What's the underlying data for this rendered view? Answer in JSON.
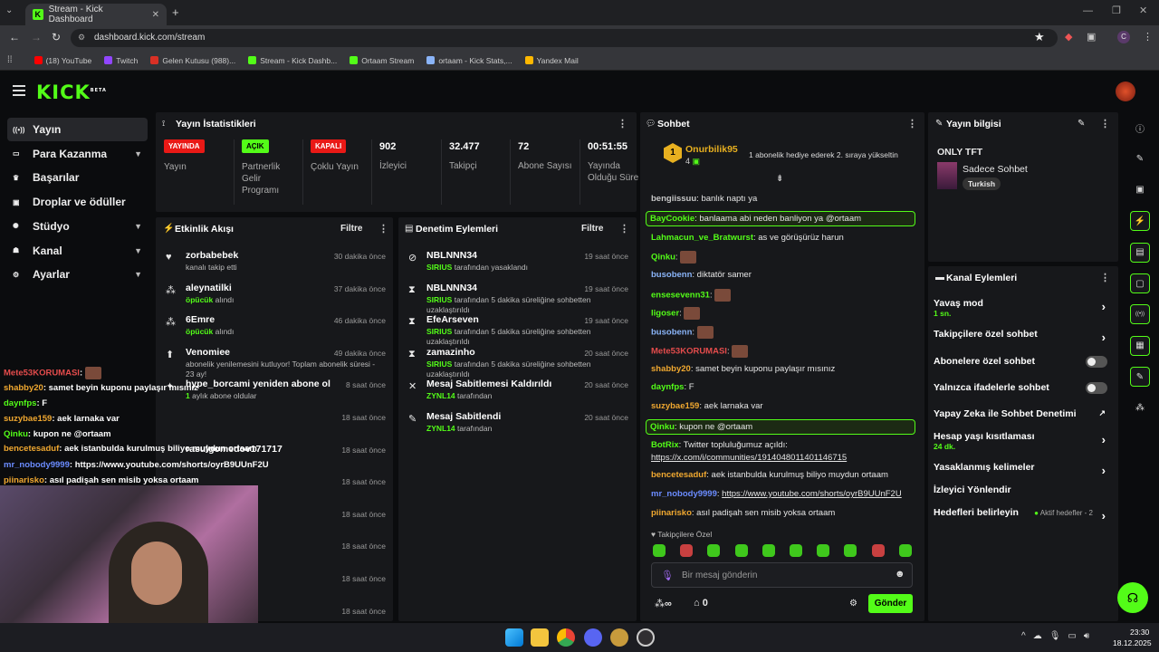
{
  "browser": {
    "tab_title": "Stream - Kick Dashboard",
    "url": "dashboard.kick.com/stream",
    "profile": "C",
    "bookmarks": [
      {
        "label": "(18) YouTube",
        "color": "#ff0000"
      },
      {
        "label": "Twitch",
        "color": "#9146ff"
      },
      {
        "label": "Gelen Kutusu (988)...",
        "color": "#d93025"
      },
      {
        "label": "Stream - Kick Dashb...",
        "color": "#53fc18"
      },
      {
        "label": "Ortaam Stream",
        "color": "#53fc18"
      },
      {
        "label": "ortaam - Kick Stats,...",
        "color": "#8ab4f8"
      },
      {
        "label": "Yandex Mail",
        "color": "#ffb800"
      }
    ]
  },
  "kick": {
    "logo": "KICK",
    "beta": "BETA"
  },
  "sidebar": {
    "items": [
      {
        "label": "Yayın",
        "icon": "broadcast-icon"
      },
      {
        "label": "Para Kazanma",
        "icon": "wallet-icon"
      },
      {
        "label": "Başarılar",
        "icon": "trophy-icon"
      },
      {
        "label": "Droplar ve ödüller",
        "icon": "gift-icon"
      },
      {
        "label": "Stüdyo",
        "icon": "gear-icon"
      },
      {
        "label": "Kanal",
        "icon": "user-icon"
      },
      {
        "label": "Ayarlar",
        "icon": "settings-icon"
      }
    ]
  },
  "stats": {
    "title": "Yayın İstatistikleri",
    "cols": [
      {
        "badge": "YAYINDA",
        "badge_color": "#e91916",
        "label": "Yayın"
      },
      {
        "badge": "AÇIK",
        "badge_color": "#53fc18",
        "label": "Partnerlik Gelir Programı"
      },
      {
        "badge": "KAPALI",
        "badge_color": "#e91916",
        "label": "Çoklu Yayın"
      },
      {
        "value": "902",
        "label": "İzleyici"
      },
      {
        "value": "32.477",
        "label": "Takipçi"
      },
      {
        "value": "72",
        "label": "Abone Sayısı"
      },
      {
        "value": "00:51:55",
        "label": "Yayında Olduğu Süre"
      }
    ]
  },
  "events": {
    "title": "Etkinlik Akışı",
    "filter": "Filtre",
    "items": [
      {
        "name": "zorbabebek",
        "sub": "kanalı takip etti",
        "time": "30 dakika önce"
      },
      {
        "name": "aleynatilki",
        "sub_green": "öpücük",
        "sub": " alındı",
        "time": "37 dakika önce"
      },
      {
        "name": "6Emre",
        "sub_green": "öpücük",
        "sub": " alındı",
        "time": "46 dakika önce"
      },
      {
        "name": "Venomiee",
        "sub": "abonelik yenilemesini kutluyor! Toplam abonelik süresi - 23 ay!",
        "time": "49 dakika önce"
      },
      {
        "name": "hype_borcami yeniden abone oldu!",
        "sub_green": "1",
        "sub": " aylık abone oldular",
        "time": "8 saat önce"
      },
      {
        "name": "",
        "time": "18 saat önce"
      },
      {
        "name": "rasulgomedov171717",
        "time": "18 saat önce"
      },
      {
        "name": "",
        "time": "18 saat önce"
      },
      {
        "name": "",
        "time": "18 saat önce"
      },
      {
        "name": "",
        "time": "18 saat önce"
      },
      {
        "name": "",
        "time": "18 saat önce"
      },
      {
        "name": "",
        "time": "18 saat önce"
      }
    ]
  },
  "mod": {
    "title": "Denetim Eylemleri",
    "filter": "Filtre",
    "items": [
      {
        "name": "NBLNNN34",
        "by": "SIRIUS",
        "sub": " tarafından yasaklandı",
        "time": "19 saat önce"
      },
      {
        "name": "NBLNNN34",
        "by": "SIRIUS",
        "sub": " tarafından 5 dakika süreliğine sohbetten uzaklaştırıldı",
        "time": "19 saat önce"
      },
      {
        "name": "EfeArseven",
        "by": "SIRIUS",
        "sub": " tarafından 5 dakika süreliğine sohbetten uzaklaştırıldı",
        "time": "19 saat önce"
      },
      {
        "name": "zamazinho",
        "by": "SIRIUS",
        "sub": " tarafından 5 dakika süreliğine sohbetten uzaklaştırıldı",
        "time": "20 saat önce"
      },
      {
        "name": "Mesaj Sabitlemesi Kaldırıldı",
        "by": "ZYNL14",
        "sub": " tarafından",
        "time": "20 saat önce"
      },
      {
        "name": "Mesaj Sabitlendi",
        "by": "ZYNL14",
        "sub": " tarafından",
        "time": "20 saat önce"
      }
    ]
  },
  "chat": {
    "title": "Sohbet",
    "pinned_user": "Onurbilik95",
    "pinned_count": "4",
    "pinned_msg": "1 abonelik hediye ederek 2. sıraya yükseltin",
    "lines": [
      {
        "user": "bengiissuu",
        "color": "#c7c7c7",
        "msg": "banlık naptı ya"
      },
      {
        "user": "BayCookie",
        "color": "#53fc18",
        "msg": "banlaama abi neden banliyon ya @ortaam",
        "hl": true
      },
      {
        "user": "Lahmacun_ve_Bratwurst",
        "color": "#53fc18",
        "msg": "as ve görüşürüz harun"
      },
      {
        "user": "Qinku",
        "color": "#53fc18",
        "msg": ""
      },
      {
        "user": "busobenn",
        "color": "#8ab4f8",
        "msg": "diktatör samer"
      },
      {
        "user": "ensesevenn31",
        "color": "#53fc18",
        "msg": ""
      },
      {
        "user": "ligoser",
        "color": "#53fc18",
        "msg": ""
      },
      {
        "user": "busobenn",
        "color": "#8ab4f8",
        "msg": ""
      },
      {
        "user": "Mete53KORUMASI",
        "color": "#e54c4c",
        "msg": ""
      },
      {
        "user": "shabby20",
        "color": "#f0a830",
        "msg": "samet beyin kuponu paylaşır mısınız"
      },
      {
        "user": "daynfps",
        "color": "#53fc18",
        "msg": "F"
      },
      {
        "user": "suzybae159",
        "color": "#f0a830",
        "msg": "aek larnaka var"
      },
      {
        "user": "Qinku",
        "color": "#53fc18",
        "msg": "kupon ne @ortaam",
        "hl": true
      },
      {
        "user": "BotRix",
        "color": "#53fc18",
        "msg": "Twitter topluluğumuz açıldı:"
      },
      {
        "user": "",
        "color": "#fff",
        "msg": "https://x.com/i/communities/1914048011401146715"
      },
      {
        "user": "bencetesaduf",
        "color": "#f0a830",
        "msg": "aek istanbulda kurulmuş biliyo muydun ortaam"
      },
      {
        "user": "mr_nobody9999",
        "color": "#6b8cff",
        "msg": "https://www.youtube.com/shorts/oyrB9UUnF2U"
      },
      {
        "user": "piinarisko",
        "color": "#f0a830",
        "msg": "asıl padişah sen misib yoksa ortaam"
      }
    ],
    "followers_only": "Takipçilere Özel",
    "placeholder": "Bir mesaj gönderin",
    "send": "Gönder",
    "points": "∞",
    "count": "0"
  },
  "info": {
    "title": "Yayın bilgisi",
    "stream_title": "ONLY TFT",
    "category": "Sadece Sohbet",
    "tag": "Turkish"
  },
  "actions": {
    "title": "Kanal Eylemleri",
    "items": [
      {
        "label": "Yavaş mod",
        "sub": "1 sn.",
        "ctrl": "chevron"
      },
      {
        "label": "Takipçilere özel sohbet",
        "ctrl": "chevron"
      },
      {
        "label": "Abonelere özel sohbet",
        "ctrl": "toggle"
      },
      {
        "label": "Yalnızca ifadelerle sohbet",
        "ctrl": "toggle"
      },
      {
        "label": "Yapay Zeka ile Sohbet Denetimi",
        "ctrl": "external"
      },
      {
        "label": "Hesap yaşı kısıtlaması",
        "sub": "24 dk.",
        "ctrl": "chevron"
      },
      {
        "label": "Yasaklanmış kelimeler",
        "ctrl": "chevron"
      },
      {
        "label": "İzleyici Yönlendir",
        "ctrl": "none"
      },
      {
        "label": "Hedefleri belirleyin",
        "ctrl": "chevron",
        "extra": "Aktif hedefler - 2"
      }
    ]
  },
  "overlay": {
    "lines": [
      {
        "user": "Mete53KORUMASI",
        "color": "#e54c4c",
        "msg": ""
      },
      {
        "user": "shabby20",
        "color": "#f0a830",
        "msg": "samet beyin kuponu paylaşır mısınız"
      },
      {
        "user": "daynfps",
        "color": "#53fc18",
        "msg": "F"
      },
      {
        "user": "suzybae159",
        "color": "#f0a830",
        "msg": "aek larnaka var"
      },
      {
        "user": "Qinku",
        "color": "#53fc18",
        "msg": "kupon ne @ortaam"
      },
      {
        "user": "bencetesaduf",
        "color": "#f0a830",
        "msg": "aek istanbulda kurulmuş biliyo muydun ortaam"
      },
      {
        "user": "mr_nobody9999",
        "color": "#6b8cff",
        "msg": "https://www.youtube.com/shorts/oyrB9UUnF2U"
      },
      {
        "user": "piinarisko",
        "color": "#f0a830",
        "msg": "asıl padişah sen misib yoksa ortaam"
      }
    ]
  },
  "taskbar": {
    "time": "23:30",
    "date": "18.12.2025"
  }
}
